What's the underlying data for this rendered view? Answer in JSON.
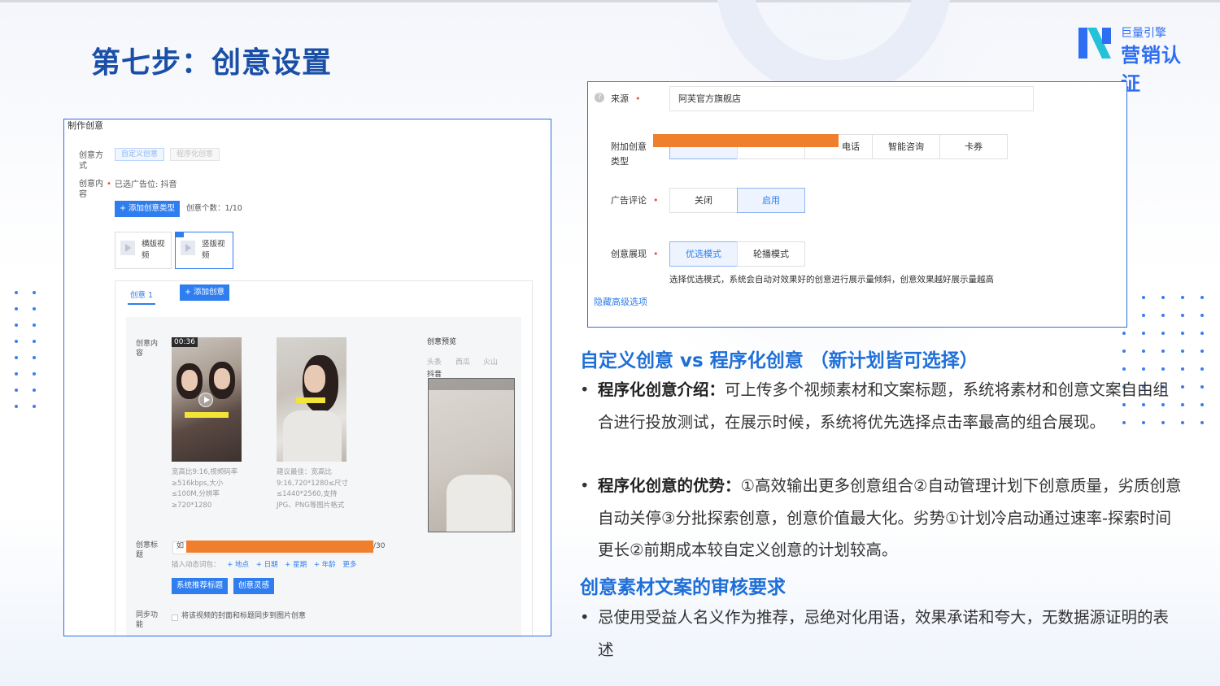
{
  "page": {
    "title": "第七步：创意设置"
  },
  "logo": {
    "small": "巨量引擎",
    "big": "营销认证"
  },
  "left_shot": {
    "title": "制作创意",
    "method_label": "创意方式",
    "method_options": [
      "自定义创意",
      "程序化创意"
    ],
    "content_label": "创意内容",
    "placement": "已选广告位: 抖音",
    "add_type_btn": "+ 添加创意类型",
    "count": "创意个数：1/10",
    "cards": [
      "横版视频",
      "竖版视频"
    ],
    "tab": "创意 1",
    "add_creative_btn": "+ 添加创意",
    "content_inner_label": "创意内容",
    "video_time": "00:36",
    "video_desc": "宽高比9:16,视频码率≥516kbps,大小≤100M,分辨率≥720*1280",
    "image_desc": "建议最佳：宽高比9:16,720*1280≤尺寸≤1440*2560,支持JPG、PNG等图片格式",
    "preview_label": "创意预览",
    "preview_tabs": [
      "头条",
      "西瓜",
      "火山",
      "抖音"
    ],
    "title_label": "创意标题",
    "title_prefix": "如",
    "title_counter": "/30",
    "insert_label": "插入动态词包：",
    "insert_links": [
      "+ 地点",
      "+ 日期",
      "+ 星期",
      "+ 年龄",
      "更多"
    ],
    "btn_recommend": "系统推荐标题",
    "btn_inspire": "创意灵感",
    "sync_label": "同步功能",
    "sync_text": "将该视频的封面和标题同步到图片创意"
  },
  "right_shot": {
    "source_label": "来源",
    "source_value": "阿芙官方旗舰店",
    "extra_label": "附加创意类型",
    "extra_options": [
      "电话",
      "智能咨询",
      "卡券"
    ],
    "comment_label": "广告评论",
    "comment_options": [
      "关闭",
      "启用"
    ],
    "display_label": "创意展现",
    "display_options": [
      "优选模式",
      "轮播模式"
    ],
    "display_hint": "选择优选模式，系统会自动对效果好的创意进行展示量倾斜，创意效果越好展示量越高",
    "hide_link": "隐藏高级选项"
  },
  "section1": {
    "heading": "自定义创意 vs 程序化创意 （新计划皆可选择）",
    "bullet1_bold": "程序化创意介绍：",
    "bullet1_text": "可上传多个视频素材和文案标题，系统将素材和创意文案自由组合进行投放测试，在展示时候，系统将优先选择点击率最高的组合展现。",
    "bullet2_bold": "程序化创意的优势：",
    "bullet2_text": "①高效输出更多创意组合②自动管理计划下创意质量，劣质创意自动关停③分批探索创意，创意价值最大化。劣势①计划冷启动通过速率-探索时间更长②前期成本较自定义创意的计划较高。"
  },
  "section2": {
    "heading": "创意素材文案的审核要求",
    "bullet1_text": "忌使用受益人名义作为推荐，忌绝对化用语，效果承诺和夸大，无数据源证明的表述"
  },
  "colors": {
    "brand": "#1a4fa8",
    "accent": "#2f7ef0",
    "redaction": "#ef7f2c"
  },
  "icons": [
    "play-icon",
    "question-icon",
    "logo-mark-icon"
  ]
}
